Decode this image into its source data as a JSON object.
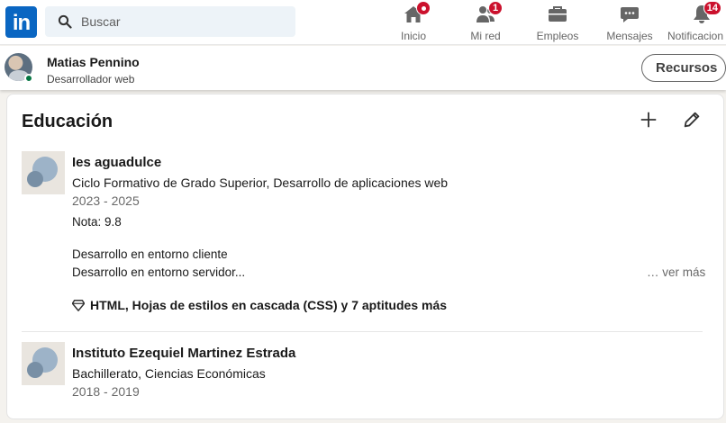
{
  "nav": {
    "logo_text": "in",
    "search_placeholder": "Buscar",
    "items": [
      {
        "label": "Inicio",
        "icon": "home-icon",
        "badge": ""
      },
      {
        "label": "Mi red",
        "icon": "people-icon",
        "badge": "1"
      },
      {
        "label": "Empleos",
        "icon": "briefcase-icon",
        "badge": ""
      },
      {
        "label": "Mensajes",
        "icon": "chat-icon",
        "badge": ""
      },
      {
        "label": "Notificacion",
        "icon": "bell-icon",
        "badge": "14"
      }
    ]
  },
  "profile": {
    "name": "Matias Pennino",
    "headline": "Desarrollador web",
    "resources_button": "Recursos"
  },
  "education": {
    "title": "Educación",
    "entries": [
      {
        "school": "Ies aguadulce",
        "degree": "Ciclo Formativo de Grado Superior, Desarrollo de aplicaciones web",
        "dates": "2023 - 2025",
        "grade": "Nota: 9.8",
        "description_lines": [
          "Desarrollo en entorno cliente",
          "Desarrollo en entorno servidor..."
        ],
        "see_more": "… ver más",
        "skills": "HTML, Hojas de estilos en cascada (CSS) y 7 aptitudes más"
      },
      {
        "school": "Instituto Ezequiel Martinez Estrada",
        "degree": "Bachillerato, Ciencias Económicas",
        "dates": "2018 - 2019"
      }
    ]
  },
  "colors": {
    "brand": "#0a66c2",
    "badge": "#cb112d",
    "online": "#057642"
  }
}
